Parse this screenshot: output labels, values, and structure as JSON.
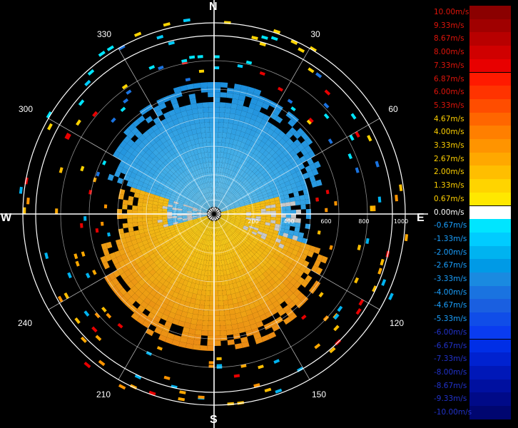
{
  "cardinals": {
    "n": "N",
    "e": "E",
    "s": "S",
    "w": "W"
  },
  "bearings": [
    "30",
    "60",
    "120",
    "150",
    "210",
    "240",
    "300",
    "330"
  ],
  "range_labels": [
    "200",
    "400",
    "600",
    "800",
    "1000"
  ],
  "legend": [
    {
      "label": "10.00m/s",
      "color": "#8b0000"
    },
    {
      "label": "9.33m/s",
      "color": "#a00000"
    },
    {
      "label": "8.67m/s",
      "color": "#b80000"
    },
    {
      "label": "8.00m/s",
      "color": "#d00000"
    },
    {
      "label": "7.33m/s",
      "color": "#e80000"
    },
    {
      "label": "6.87m/s",
      "color": "#ff1a00"
    },
    {
      "label": "6.00m/s",
      "color": "#ff3300"
    },
    {
      "label": "5.33m/s",
      "color": "#ff4d00"
    },
    {
      "label": "4.67m/s",
      "color": "#ff6600"
    },
    {
      "label": "4.00m/s",
      "color": "#ff7f00"
    },
    {
      "label": "3.33m/s",
      "color": "#ff9400"
    },
    {
      "label": "2.67m/s",
      "color": "#ffa800"
    },
    {
      "label": "2.00m/s",
      "color": "#ffbe00"
    },
    {
      "label": "1.33m/s",
      "color": "#ffd400"
    },
    {
      "label": "0.67m/s",
      "color": "#ffe800"
    },
    {
      "label": "0.00m/s",
      "color": "#ffffff"
    },
    {
      "label": "-0.67m/s",
      "color": "#00e5ff"
    },
    {
      "label": "-1.33m/s",
      "color": "#00ccff"
    },
    {
      "label": "-2.00m/s",
      "color": "#00b3f0"
    },
    {
      "label": "-2.67m/s",
      "color": "#009ae6"
    },
    {
      "label": "-3.33m/s",
      "color": "#1a8ae0"
    },
    {
      "label": "-4.00m/s",
      "color": "#1a73e0"
    },
    {
      "label": "-4.67m/s",
      "color": "#1a5fe0"
    },
    {
      "label": "-5.33m/s",
      "color": "#104de8"
    },
    {
      "label": "-6.00m/s",
      "color": "#0a3cf0"
    },
    {
      "label": "-6.67m/s",
      "color": "#002ee6"
    },
    {
      "label": "-7.33m/s",
      "color": "#0022d0"
    },
    {
      "label": "-8.00m/s",
      "color": "#0018b8"
    },
    {
      "label": "-8.67m/s",
      "color": "#0010a0"
    },
    {
      "label": "-9.33m/s",
      "color": "#000a88"
    },
    {
      "label": "-10.00m/s",
      "color": "#000670"
    }
  ],
  "legend_text_colors": {
    "positive": "#e0140a",
    "positive_low": "#ffd000",
    "zero": "#ffffff",
    "negative": "#1aa0ff",
    "negative_low": "#2233cc"
  }
}
